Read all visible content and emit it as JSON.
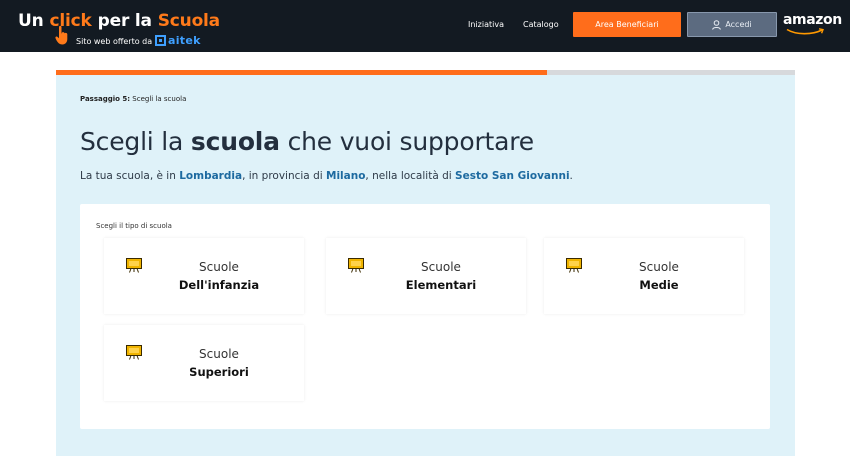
{
  "header": {
    "brand_un": "Un",
    "brand_click": "click",
    "brand_per": "per la",
    "brand_scuola": "Scuola",
    "brand_subtitle": "Sito web offerto da",
    "partner_logo": "aitek",
    "nav": {
      "iniziativa": "Iniziativa",
      "catalogo": "Catalogo"
    },
    "area_beneficiari_label": "Area Beneficiari",
    "accedi_label": "Accedi",
    "amazon_logo": "amazon",
    "colors": {
      "bar": "#131a22",
      "accent": "#ff6d1b"
    }
  },
  "progress": {
    "fraction": 0.665
  },
  "step": {
    "prefix": "Passaggio 5:",
    "text": "Scegli la scuola"
  },
  "title": {
    "part1": "Scegli la",
    "bold": "scuola",
    "part2": "che vuoi supportare"
  },
  "subtitle": {
    "t1": "La tua scuola, è in",
    "region": "Lombardia",
    "t2": ", in provincia di",
    "province": "Milano",
    "t3": ", nella località di",
    "city": "Sesto San Giovanni",
    "t4": "."
  },
  "school_type": {
    "label": "Scegli il tipo di scuola",
    "options": [
      {
        "line1": "Scuole",
        "line2": "Dell'infanzia",
        "icon": "blackboard-icon"
      },
      {
        "line1": "Scuole",
        "line2": "Elementari",
        "icon": "blackboard-icon"
      },
      {
        "line1": "Scuole",
        "line2": "Medie",
        "icon": "blackboard-icon"
      },
      {
        "line1": "Scuole",
        "line2": "Superiori",
        "icon": "blackboard-icon"
      }
    ]
  }
}
